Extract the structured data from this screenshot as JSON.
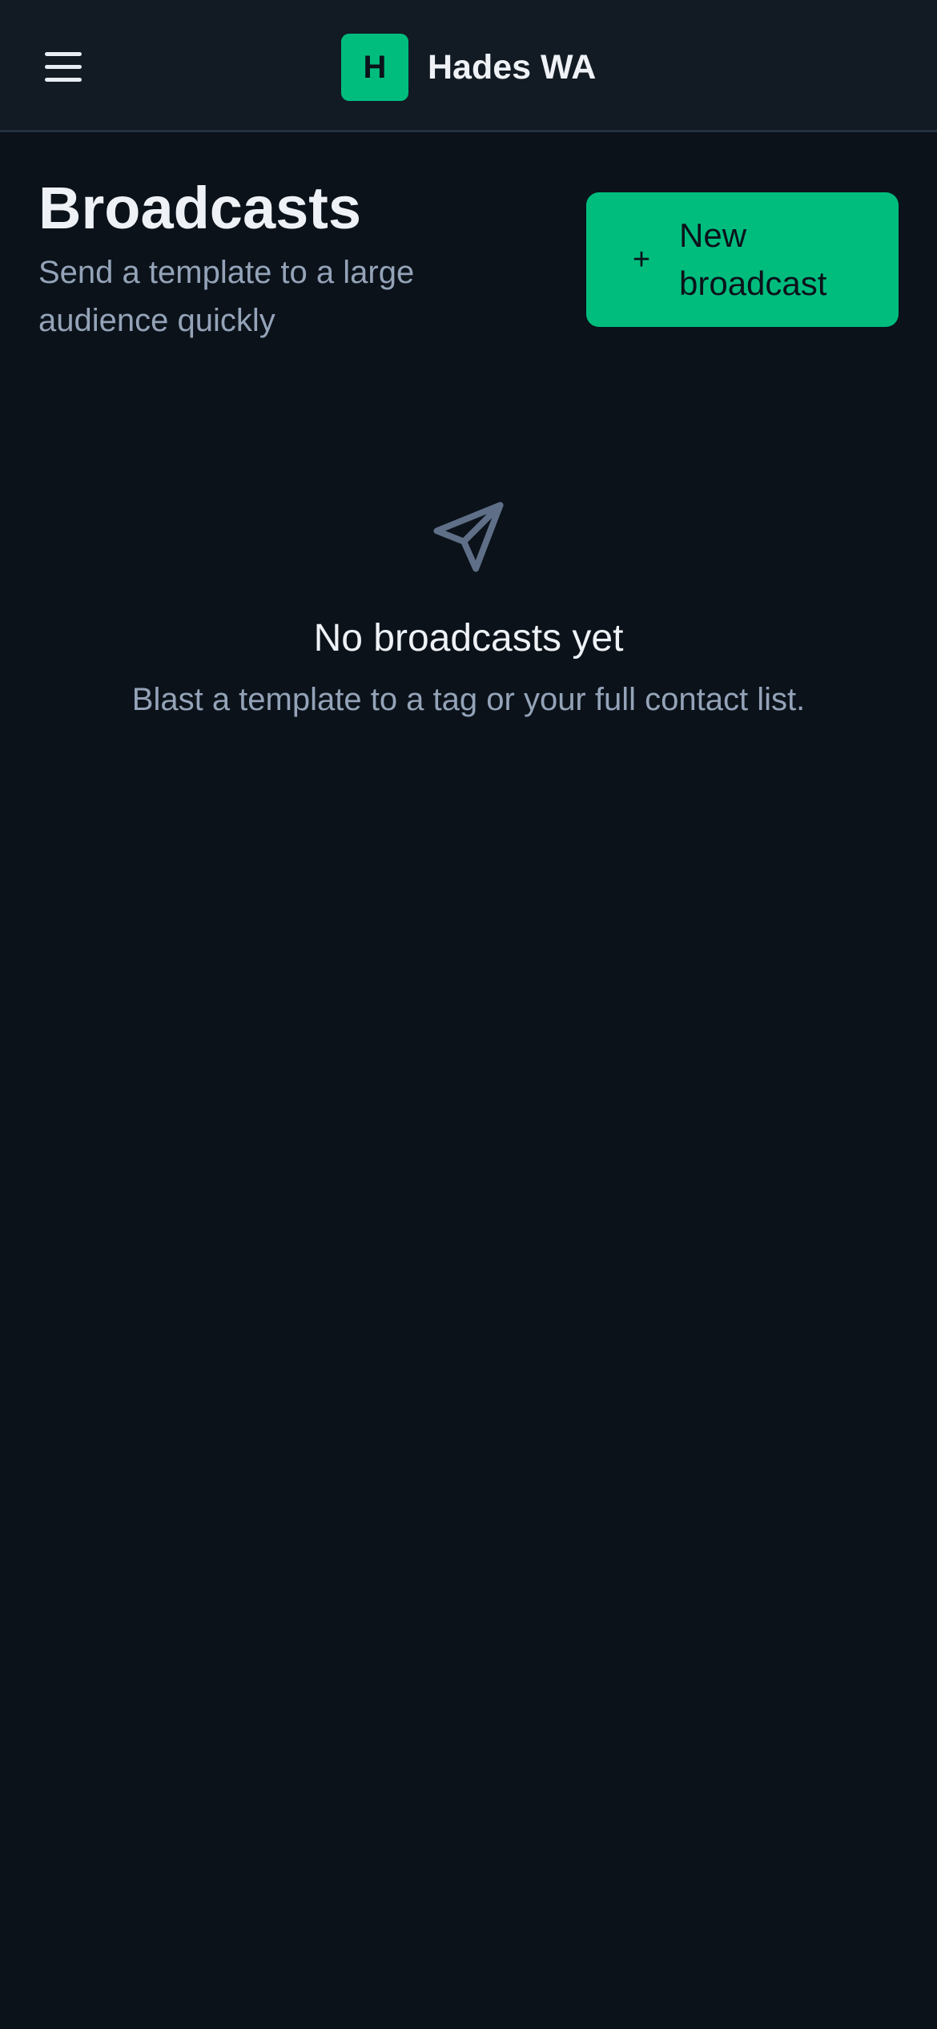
{
  "app": {
    "logo_letter": "H",
    "name": "Hades WA"
  },
  "header": {
    "title": "Broadcasts",
    "subtitle": "Send a template to a large audience quickly",
    "new_button": {
      "icon": "+",
      "label": "New broadcast"
    }
  },
  "empty_state": {
    "icon": "send-icon",
    "title": "No broadcasts yet",
    "description": "Blast a template to a tag or your full contact list."
  },
  "colors": {
    "background": "#0b121a",
    "topbar": "#121a23",
    "accent": "#00bd7e",
    "muted_text": "#94a3b8",
    "icon_muted": "#5f6f87"
  }
}
